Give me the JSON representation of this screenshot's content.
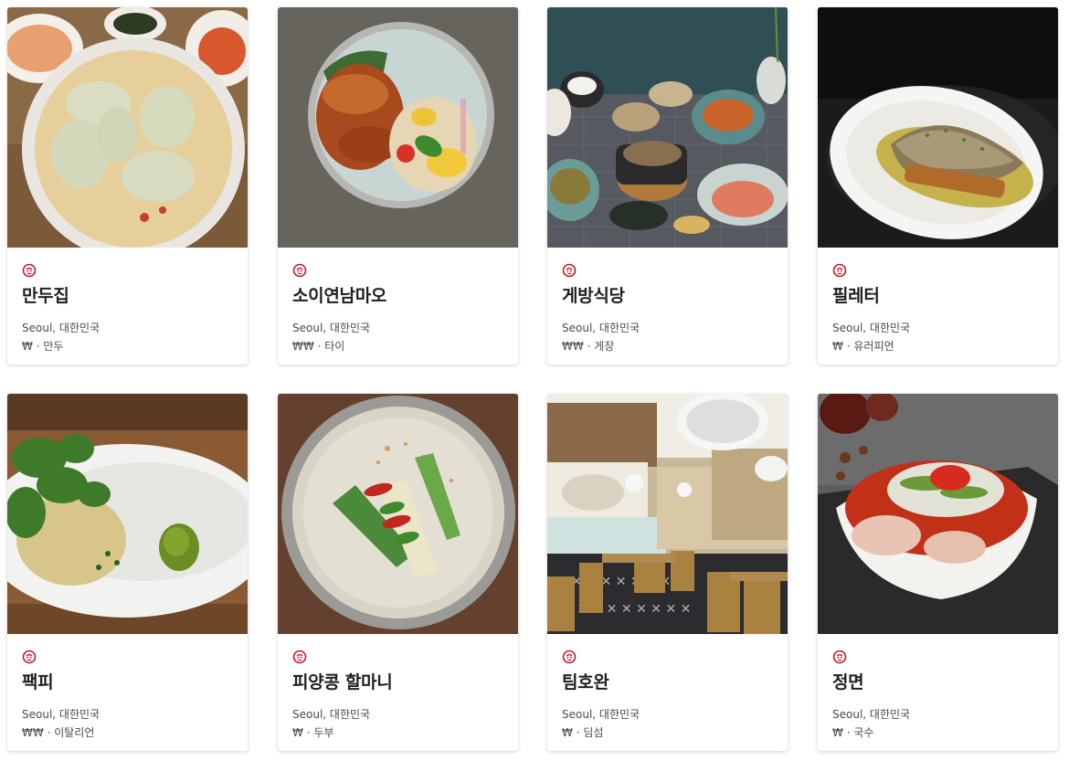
{
  "restaurants": [
    {
      "name": "만두집",
      "location": "Seoul, 대한민국",
      "price": "₩",
      "cuisine": "만두",
      "photo": "dumpling-soup"
    },
    {
      "name": "소이연남마오",
      "location": "Seoul, 대한민국",
      "price": "₩₩",
      "cuisine": "타이",
      "photo": "grilled-chicken-papaya-salad"
    },
    {
      "name": "게방식당",
      "location": "Seoul, 대한민국",
      "price": "₩₩",
      "cuisine": "게장",
      "photo": "korean-table-spread"
    },
    {
      "name": "필레터",
      "location": "Seoul, 대한민국",
      "price": "₩",
      "cuisine": "유러피언",
      "photo": "fish-fillet-plate"
    },
    {
      "name": "팩피",
      "location": "Seoul, 대한민국",
      "price": "₩₩",
      "cuisine": "이탈리언",
      "photo": "herb-pasta-plate"
    },
    {
      "name": "피양콩 할마니",
      "location": "Seoul, 대한민국",
      "price": "₩",
      "cuisine": "두부",
      "photo": "soy-milk-noodles"
    },
    {
      "name": "팀호완",
      "location": "Seoul, 대한민국",
      "price": "₩",
      "cuisine": "딤섬",
      "photo": "restaurant-interior"
    },
    {
      "name": "정면",
      "location": "Seoul, 대한민국",
      "price": "₩",
      "cuisine": "국수",
      "photo": "spicy-noodle-bowl"
    }
  ],
  "separator": "·",
  "badge_icon": "michelin-bib-gourmand-icon",
  "colors": {
    "badge": "#c4172c",
    "title": "#1f1f1f",
    "text": "#4a4a4a"
  }
}
